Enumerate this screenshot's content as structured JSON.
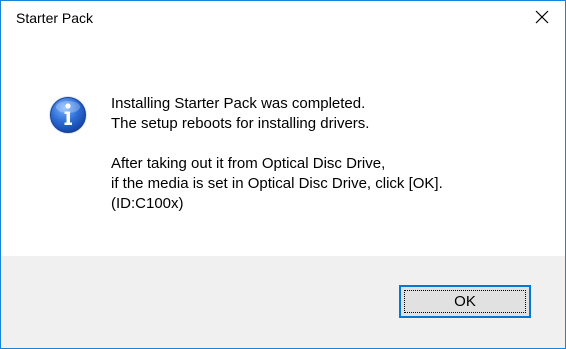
{
  "window": {
    "title": "Starter Pack"
  },
  "icons": {
    "close": "close-icon",
    "info": "information-icon"
  },
  "message": {
    "lines": [
      "Installing Starter Pack was completed.",
      "The setup reboots for installing drivers.",
      "",
      "After taking out it from Optical Disc Drive,",
      "if the media is set in Optical Disc Drive, click [OK].",
      "(ID:C100x)"
    ]
  },
  "buttons": {
    "ok_label": "OK"
  },
  "colors": {
    "accent": "#0078d7",
    "window_border": "#1883d7",
    "footer_bg": "#f0f0f0"
  }
}
